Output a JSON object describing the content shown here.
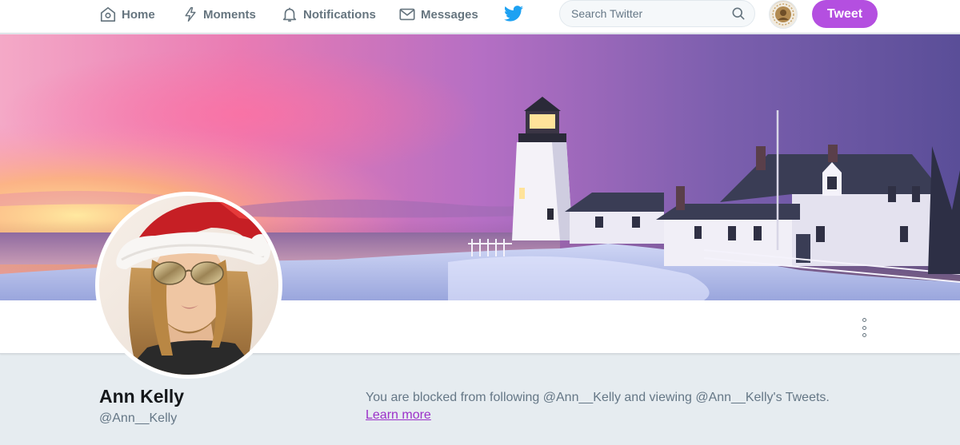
{
  "nav": {
    "home_label": "Home",
    "moments_label": "Moments",
    "notifications_label": "Notifications",
    "messages_label": "Messages",
    "search_placeholder": "Search Twitter",
    "tweet_label": "Tweet"
  },
  "profile": {
    "name": "Ann Kelly",
    "handle": "@Ann__Kelly",
    "blocked_message": "You are blocked from following @Ann__Kelly and viewing @Ann__Kelly's Tweets.",
    "learn_more_label": "Learn more"
  },
  "colors": {
    "accent": "#b44fe0",
    "link": "#9b30c9",
    "twitter_blue": "#1da1f2",
    "nav_text": "#66757f",
    "page_bg": "#e6ecf0"
  },
  "icons": {
    "home": "home-icon",
    "moments": "lightning-icon",
    "notifications": "bell-icon",
    "messages": "envelope-icon",
    "brand": "twitter-bird-icon",
    "search": "search-icon",
    "more": "vertical-dots-icon"
  }
}
